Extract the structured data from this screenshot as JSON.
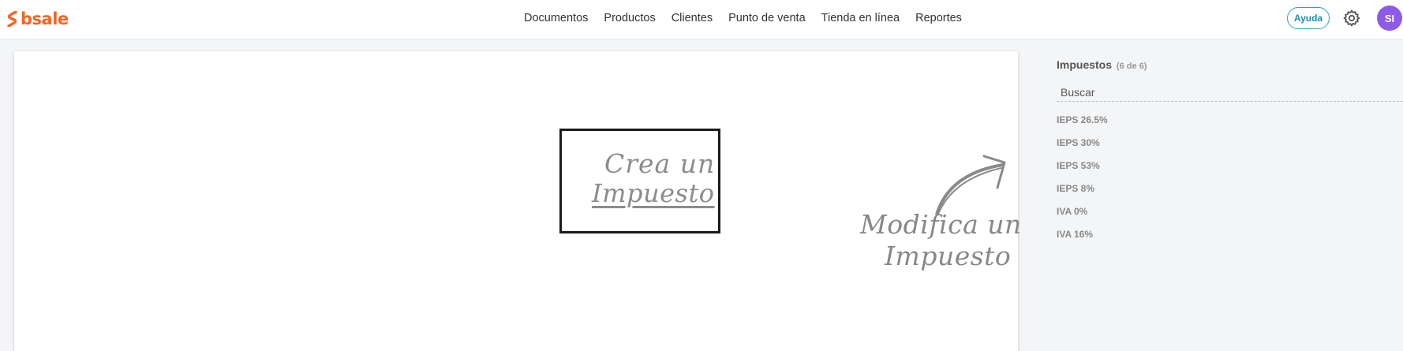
{
  "app": {
    "logo_text": "bsale",
    "brand_color": "#f26522",
    "logo_icon": "bsale-logo-icon"
  },
  "nav": {
    "items": [
      {
        "label": "Documentos"
      },
      {
        "label": "Productos"
      },
      {
        "label": "Clientes"
      },
      {
        "label": "Punto de venta"
      },
      {
        "label": "Tienda en línea"
      },
      {
        "label": "Reportes"
      }
    ]
  },
  "header": {
    "help_label": "Ayuda",
    "help_color": "#2aa3c6",
    "settings_icon": "gear-icon",
    "avatar_initials": "SI",
    "avatar_color": "#8e5be8"
  },
  "canvas": {
    "create_line1": "Crea un",
    "create_line2": "Impuesto",
    "modify_line1": "Modifica un",
    "modify_line2": "Impuesto"
  },
  "sidebar": {
    "title": "Impuestos",
    "count": "(6 de 6)",
    "search_placeholder": "Buscar",
    "items": [
      {
        "label": "IEPS 26.5%"
      },
      {
        "label": "IEPS 30%"
      },
      {
        "label": "IEPS 53%"
      },
      {
        "label": "IEPS 8%"
      },
      {
        "label": "IVA 0%"
      },
      {
        "label": "IVA 16%"
      }
    ]
  }
}
